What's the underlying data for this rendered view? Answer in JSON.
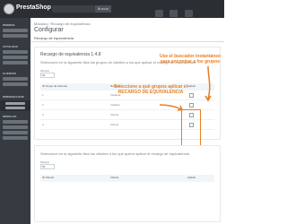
{
  "topbar": {
    "brand": "PrestaShop",
    "search_button": "Buscar"
  },
  "sidebar": {
    "sections": [
      "PEDIDOS",
      "CATÁLOGO",
      "CLIENTES",
      "PERSONALIZAR",
      "MÓDULOS"
    ]
  },
  "header": {
    "breadcrumb": "Módulos / Recargo de equivalencia",
    "title": "Configurar",
    "subtitle": "Recargo de equivalencia"
  },
  "panel1": {
    "title": "Recargo de equivalencia 1.4.8",
    "desc": "Seleccione en la siguiente lista los grupos de clientes a los que aplicar el recargo de equivalencia",
    "small_label": "Mostrar",
    "select_value": "50",
    "columns": [
      "ID Grupo de Clientes",
      "Nombre",
      "Aplicar"
    ],
    "rows": [
      {
        "id": "1",
        "name": "Visitante"
      },
      {
        "id": "2",
        "name": "Invitado"
      },
      {
        "id": "3",
        "name": "Cliente"
      },
      {
        "id": "4",
        "name": "Cliente"
      }
    ]
  },
  "annotations": {
    "select_groups": "Seleccione a qué grupos aplicar el RECARGO DE EQUIVALENCIA",
    "search_tip": "Use el buscador instantáneo para encontrar a los grupos"
  },
  "panel2": {
    "desc": "Seleccione en la siguiente lista los clientes a los que quiere aplicar el recargo de equivalencia",
    "small_label": "Mostrar",
    "select_value": "50",
    "columns": [
      "ID Cliente",
      "Cliente",
      "Aplicar"
    ]
  }
}
